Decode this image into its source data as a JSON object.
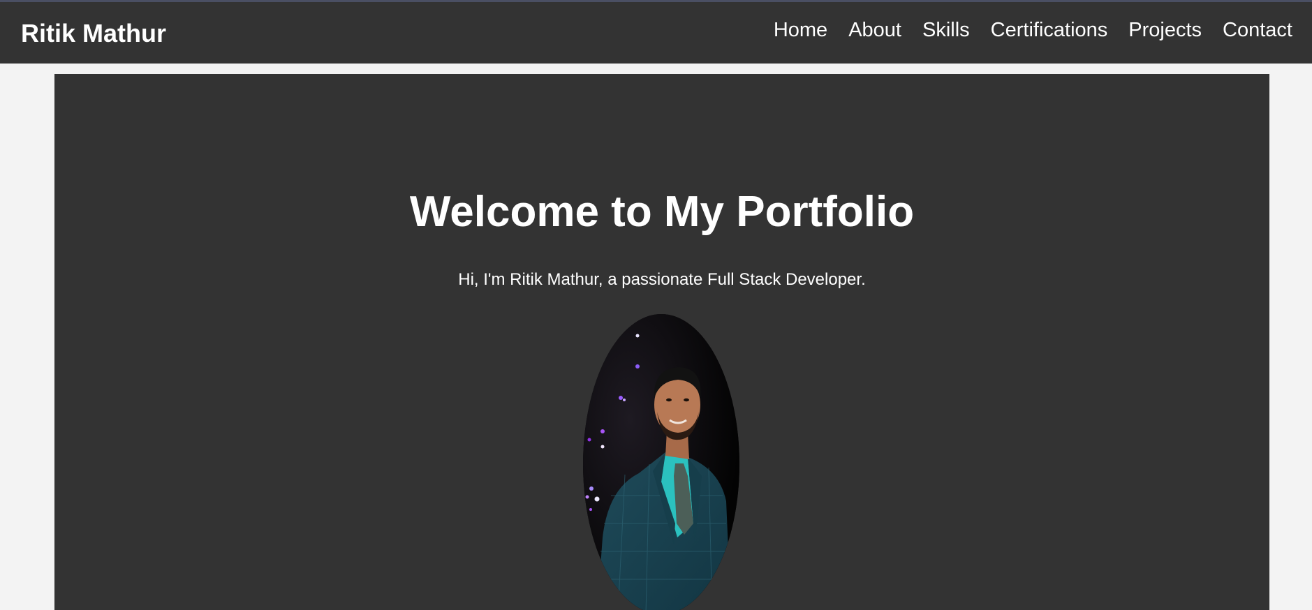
{
  "header": {
    "brand": "Ritik Mathur",
    "nav": [
      {
        "label": "Home"
      },
      {
        "label": "About"
      },
      {
        "label": "Skills"
      },
      {
        "label": "Certifications"
      },
      {
        "label": "Projects"
      },
      {
        "label": "Contact"
      }
    ]
  },
  "hero": {
    "title": "Welcome to My Portfolio",
    "subtitle": "Hi, I'm Ritik Mathur, a passionate Full Stack Developer.",
    "image_subject": "profile-photo"
  },
  "colors": {
    "page_background": "#f3f3f3",
    "header_background": "#333333",
    "hero_background": "#333333",
    "text": "#ffffff"
  }
}
